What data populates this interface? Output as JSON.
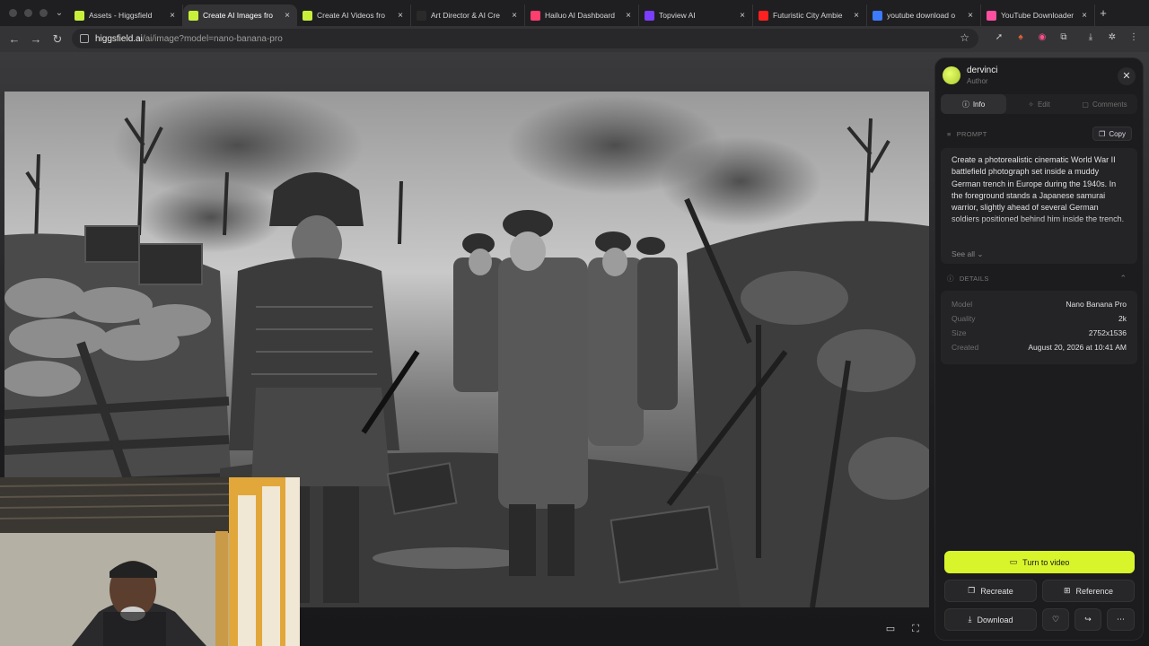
{
  "browser": {
    "tabs": [
      {
        "title": "Assets - Higgsfield",
        "active": false,
        "icon": "higgsfield-icon",
        "icon_color": "#c8f03a"
      },
      {
        "title": "Create AI Images fro",
        "active": true,
        "icon": "higgsfield-icon",
        "icon_color": "#c8f03a"
      },
      {
        "title": "Create AI Videos fro",
        "active": false,
        "icon": "higgsfield-icon",
        "icon_color": "#c8f03a"
      },
      {
        "title": "Art Director & AI Cre",
        "active": false,
        "icon": "chatgpt-icon",
        "icon_color": "#2a2a2a"
      },
      {
        "title": "Hailuo AI Dashboard",
        "active": false,
        "icon": "hailuo-icon",
        "icon_color": "#ff3d6e"
      },
      {
        "title": "Topview AI",
        "active": false,
        "icon": "topview-icon",
        "icon_color": "#7b3dff"
      },
      {
        "title": "Futuristic City Ambie",
        "active": false,
        "icon": "youtube-icon",
        "icon_color": "#ff2020"
      },
      {
        "title": "youtube download o",
        "active": false,
        "icon": "search-icon",
        "icon_color": "#3c7bff"
      },
      {
        "title": "YouTube Downloader",
        "active": false,
        "icon": "downloader-icon",
        "icon_color": "#ff4fa0"
      }
    ],
    "url_host": "higgsfield.ai",
    "url_path": "/ai/image?model=nano-banana-pro"
  },
  "panel": {
    "author_name": "dervinci",
    "author_role": "Author",
    "tabs": [
      {
        "label": "Info",
        "active": true
      },
      {
        "label": "Edit",
        "active": false
      },
      {
        "label": "Comments",
        "active": false
      }
    ],
    "prompt_heading": "PROMPT",
    "copy_label": "Copy",
    "prompt_text": "Create a photorealistic cinematic World War II battlefield photograph set inside a muddy German trench in Europe during the 1940s. In the foreground stands a Japanese samurai warrior, slightly ahead of several German soldiers positioned behind him inside the trench.",
    "see_all_label": "See all",
    "details_heading": "DETAILS",
    "details": [
      {
        "key": "Model",
        "value": "Nano Banana Pro"
      },
      {
        "key": "Quality",
        "value": "2k"
      },
      {
        "key": "Size",
        "value": "2752x1536"
      },
      {
        "key": "Created",
        "value": "August 20, 2026 at 10:41 AM"
      }
    ],
    "turn_to_video_label": "Turn to video",
    "recreate_label": "Recreate",
    "reference_label": "Reference",
    "download_label": "Download",
    "accent_color": "#d8f52c"
  }
}
